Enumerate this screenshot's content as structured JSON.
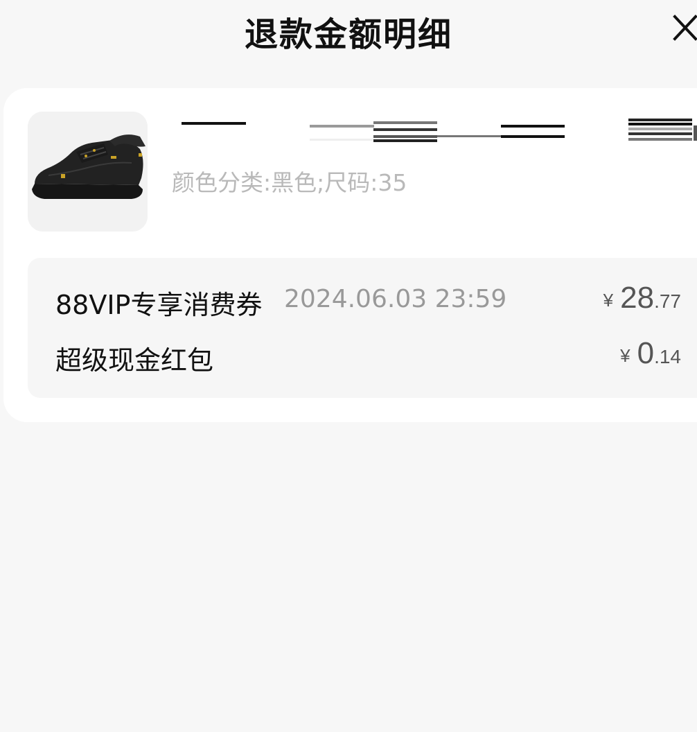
{
  "header": {
    "title": "退款金额明细",
    "close_icon": "close-icon"
  },
  "product": {
    "image_icon": "sneaker-image",
    "spec": "颜色分类:黑色;尺码:35"
  },
  "discounts": [
    {
      "label": "88VIP专享消费券",
      "date": "2024.06.03 23:59",
      "currency": "¥",
      "amount_int": "28",
      "amount_dec": ".77"
    },
    {
      "label": "超级现金红包",
      "date": "",
      "currency": "¥",
      "amount_int": "0",
      "amount_dec": ".14"
    }
  ],
  "colors": {
    "background": "#f7f7f7",
    "card": "#ffffff",
    "spec_text": "#b9b9b9",
    "amount_text": "#555555"
  }
}
